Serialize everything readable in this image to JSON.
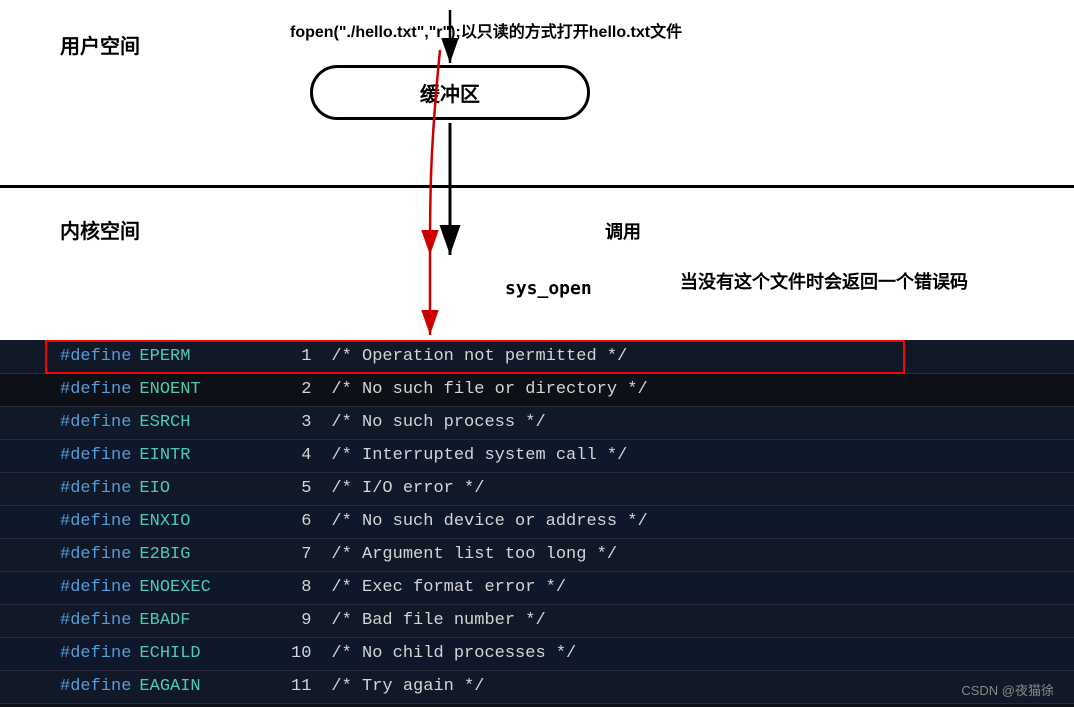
{
  "top": {
    "user_space_label": "用户空间",
    "kernel_space_label": "内核空间",
    "fopen_label": "fopen(\"./hello.txt\",\"r\");以只读的方式打开hello.txt文件",
    "buffer_label": "缓冲区",
    "call_label": "调用",
    "sys_open_label": "sys_open",
    "error_label": "当没有这个文件时会返回一个错误码"
  },
  "code": {
    "rows": [
      {
        "define": "#define",
        "name": "EPERM",
        "num": "1",
        "comment": "/* Operation not permitted */"
      },
      {
        "define": "#define",
        "name": "ENOENT",
        "num": "2",
        "comment": "/* No such file or directory */",
        "highlighted": true
      },
      {
        "define": "#define",
        "name": "ESRCH",
        "num": "3",
        "comment": "/* No such process */"
      },
      {
        "define": "#define",
        "name": "EINTR",
        "num": "4",
        "comment": "/* Interrupted system call */"
      },
      {
        "define": "#define",
        "name": "EIO",
        "num": "5",
        "comment": "/* I/O error */"
      },
      {
        "define": "#define",
        "name": "ENXIO",
        "num": "6",
        "comment": "/* No such device or address */"
      },
      {
        "define": "#define",
        "name": "E2BIG",
        "num": "7",
        "comment": "/* Argument list too long */"
      },
      {
        "define": "#define",
        "name": "ENOEXEC",
        "num": "8",
        "comment": "/* Exec format error */"
      },
      {
        "define": "#define",
        "name": "EBADF",
        "num": "9",
        "comment": "/* Bad file number */"
      },
      {
        "define": "#define",
        "name": "ECHILD",
        "num": "10",
        "comment": "/* No child processes */"
      },
      {
        "define": "#define",
        "name": "EAGAIN",
        "num": "11",
        "comment": "/* Try again */"
      }
    ]
  },
  "watermark": "CSDN @夜猫徐"
}
